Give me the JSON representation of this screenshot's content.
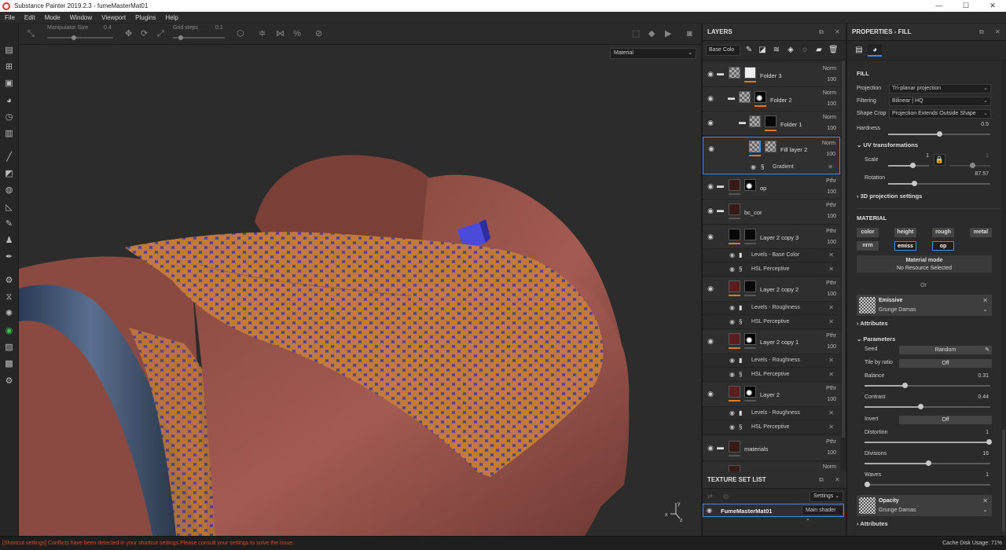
{
  "window": {
    "title": "Substance Painter 2019.2.3 - fumeMasterMat01",
    "controls": [
      "—",
      "☐",
      "✕"
    ]
  },
  "menu": [
    "File",
    "Edit",
    "Mode",
    "Window",
    "Viewport",
    "Plugins",
    "Help"
  ],
  "toolbar": {
    "manipulator_label": "Manipulator Size",
    "manipulator_value": "0.4",
    "grid_label": "Grid steps",
    "grid_value": "0.1"
  },
  "viewport": {
    "mode_select": "Material"
  },
  "layers_panel": {
    "title": "LAYERS",
    "channel": "Base Colo",
    "rows": [
      {
        "name": "Folder 3",
        "blend": "Norm",
        "opacity": "100"
      },
      {
        "name": "Folder 2",
        "blend": "Norm",
        "opacity": "100"
      },
      {
        "name": "Folder 1",
        "blend": "Norm",
        "opacity": "100"
      },
      {
        "name": "Fill layer 2",
        "blend": "Norm",
        "opacity": "100"
      },
      {
        "name": "op",
        "blend": "Pthr",
        "opacity": "100"
      },
      {
        "name": "bc_cor",
        "blend": "Pthr",
        "opacity": "100"
      },
      {
        "name": "Layer 2 copy 3",
        "blend": "Pthr",
        "opacity": "100"
      },
      {
        "name": "Layer 2 copy 2",
        "blend": "Pthr",
        "opacity": "100"
      },
      {
        "name": "Layer 2 copy 1",
        "blend": "Pthr",
        "opacity": "100"
      },
      {
        "name": "Layer 2",
        "blend": "Pthr",
        "opacity": "100"
      },
      {
        "name": "materials",
        "blend": "Pthr",
        "opacity": "100"
      },
      {
        "name": "",
        "blend": "Norm",
        "opacity": ""
      }
    ],
    "effects": [
      "Gradient",
      "Levels - Base Color",
      "HSL Perceptive",
      "Levels - Roughness",
      "HSL Perceptive",
      "Levels - Roughness",
      "HSL Perceptive",
      "Levels - Roughness",
      "HSL Perceptive"
    ]
  },
  "texture_set_list": {
    "title": "TEXTURE SET LIST",
    "settings_button": "Settings",
    "items": [
      {
        "name": "FumeMasterMat01",
        "shader": "Main shader"
      }
    ]
  },
  "properties": {
    "title": "PROPERTIES - FILL",
    "fill_section": "FILL",
    "projection_label": "Projection",
    "projection_value": "Tri-planar projection",
    "filtering_label": "Filtering",
    "filtering_value": "Bilinear | HQ",
    "shape_crop_label": "Shape Crop",
    "shape_crop_value": "Projection Extends Outside Shape",
    "hardness_label": "Hardness",
    "hardness_value": "0.5",
    "uv_section": "UV transformations",
    "scale_label": "Scale",
    "scale_value": "1",
    "scale_value2": "1",
    "rotation_label": "Rotation",
    "rotation_value": "87.57",
    "projection3d_section": "3D projection settings",
    "material_section": "MATERIAL",
    "channels": [
      "color",
      "height",
      "rough",
      "metal",
      "nrm",
      "emiss",
      "op"
    ],
    "material_mode_title": "Material mode",
    "material_mode_value": "No Resource Selected",
    "or_text": "Or",
    "emissive_title": "Emissive",
    "emissive_resource": "Grunge Damas",
    "attributes_label": "Attributes",
    "parameters_label": "Parameters",
    "seed_label": "Seed",
    "seed_value": "Random",
    "tile_label": "Tile by ratio",
    "tile_value": "Off",
    "balance_label": "Balance",
    "balance_value": "0.31",
    "contrast_label": "Contrast",
    "contrast_value": "0.44",
    "invert_label": "Invert",
    "invert_value": "Off",
    "distortion_label": "Distortion",
    "distortion_value": "1",
    "divisions_label": "Divisions",
    "divisions_value": "16",
    "waves_label": "Waves",
    "waves_value": "1",
    "opacity_title": "Opacity",
    "opacity_resource": "Grunge Damas",
    "attributes_label2": "Attributes"
  },
  "status": {
    "warning": "[Shortcut settings] Conflicts have been detected in your shortcut settings.Please consult your settings to solve the issue.",
    "cache": "Cache Disk Usage:   71%"
  },
  "colors": {
    "accent": "#3a8ee6",
    "orange": "#e07a20",
    "warning": "#e0491b"
  }
}
